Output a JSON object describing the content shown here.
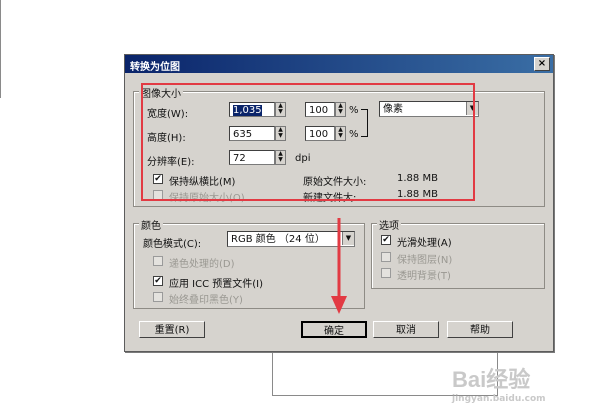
{
  "dialog": {
    "title": "转换为位图",
    "close_icon": "×"
  },
  "image_size": {
    "group_label": "图像大小",
    "width_label": "宽度(W):",
    "width_value": "1,035",
    "width_pct": "100",
    "height_label": "高度(H):",
    "height_value": "635",
    "height_pct": "100",
    "pct_unit": "%",
    "unit_value": "像素",
    "resolution_label": "分辨率(E):",
    "resolution_value": "72",
    "resolution_unit": "dpi",
    "keep_ratio_label": "保持纵横比(M)",
    "keep_original_label": "保持原始大小(O)",
    "original_size_label": "原始文件大小:",
    "original_size_value": "1.88 MB",
    "new_size_label": "新建文件大:",
    "new_size_value": "1.88 MB"
  },
  "color": {
    "group_label": "颜色",
    "mode_label": "颜色模式(C):",
    "mode_value": "RGB 颜色 （24 位）",
    "dither_label": "递色处理的(D)",
    "icc_label": "应用 ICC 预置文件(I)",
    "overprint_label": "始终叠印黑色(Y)"
  },
  "options": {
    "group_label": "选项",
    "smooth_label": "光滑处理(A)",
    "keep_layers_label": "保持图层(N)",
    "transparent_label": "透明背景(T)"
  },
  "buttons": {
    "reset": "重置(R)",
    "ok": "确定",
    "cancel": "取消",
    "help": "帮助"
  },
  "watermark": {
    "text": "Bai经验",
    "subtext": "jingyan.baidu.com"
  },
  "colors": {
    "highlight": "#e23a43",
    "title_start": "#0a246a",
    "title_end": "#3a6ea5",
    "dialog_bg": "#d6d3ce"
  }
}
